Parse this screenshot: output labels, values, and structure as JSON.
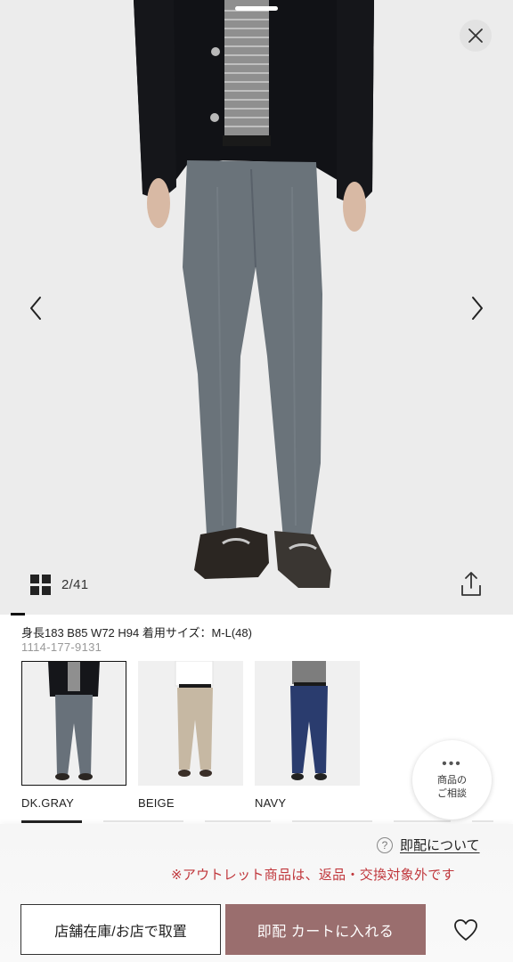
{
  "gallery": {
    "counter": "2/41",
    "icons": {
      "close": "close-icon",
      "prev": "chevron-left-icon",
      "next": "chevron-right-icon",
      "grid": "grid-icon",
      "share": "share-icon"
    }
  },
  "product": {
    "model_info": "身長183 B85 W72 H94 着用サイズ：M-L(48)",
    "code": "1114-177-9131"
  },
  "colors": [
    {
      "label": "DK.GRAY",
      "selected": true,
      "pant_color": "#68717a"
    },
    {
      "label": "BEIGE",
      "selected": false,
      "pant_color": "#c6b8a3"
    },
    {
      "label": "NAVY",
      "selected": false,
      "pant_color": "#2a3c6e"
    }
  ],
  "consult": {
    "line1": "商品の",
    "line2": "ご相談"
  },
  "delivery": {
    "help_icon": "?",
    "link_label": "即配について"
  },
  "notice": "※アウトレット商品は、返品・交換対象外です",
  "actions": {
    "store_button": "店舗在庫/お店で取置",
    "cart_button": "即配 カートに入れる",
    "favorite_icon": "heart-icon"
  },
  "theme": {
    "accent": "#9a6e6e",
    "notice_color": "#c0373c"
  }
}
